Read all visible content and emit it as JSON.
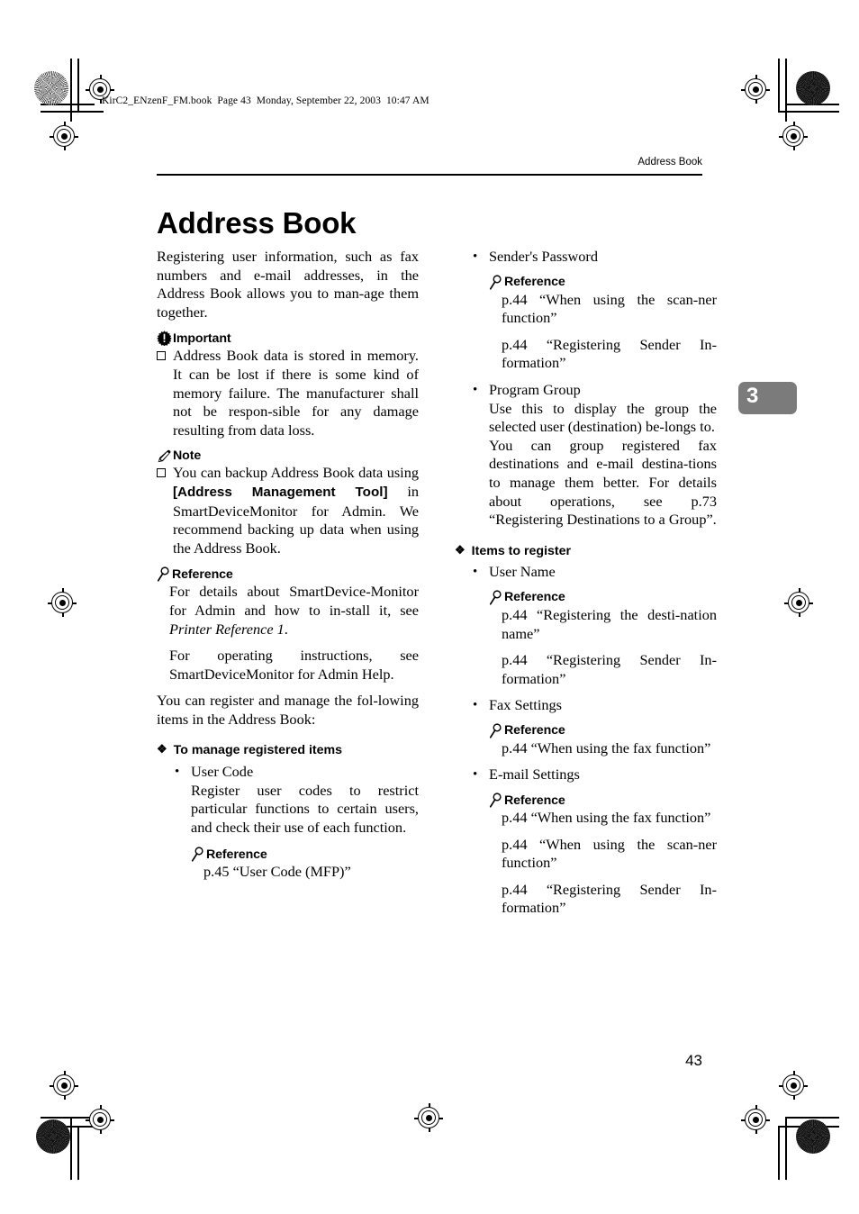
{
  "file_header": "KirC2_ENzenF_FM.book  Page 43  Monday, September 22, 2003  10:47 AM",
  "running_header": "Address Book",
  "chapter_title": "Address Book",
  "chapter_tab_number": "3",
  "page_number": "43",
  "colors": {
    "chapter_tab_background": "#7b7b7b",
    "chapter_tab_text": "#ffffff",
    "text": "#000000",
    "page_background": "#ffffff"
  },
  "left_column": {
    "intro": "Registering user information, such as fax numbers and e-mail addresses, in the Address Book allows you to man-age them together.",
    "important": {
      "heading": "Important",
      "icon": "important-starburst-icon",
      "items": [
        "Address Book data is stored in memory. It can be lost if there is some kind of memory failure. The manufacturer shall not be respon-sible for any damage resulting from data loss."
      ]
    },
    "note": {
      "heading": "Note",
      "icon": "note-pencil-icon",
      "item_part1": "You can backup Address Book data using ",
      "item_bold": "[Address Management Tool]",
      "item_part2": " in SmartDeviceMonitor for Admin. We recommend backing up data when using the Address Book."
    },
    "reference": {
      "heading": "Reference",
      "icon": "reference-magnifier-icon",
      "para1_pre": "For details about SmartDevice-Monitor for Admin and how to in-stall it, see ",
      "para1_italic": "Printer Reference 1",
      "para1_post": ".",
      "para2": "For operating instructions, see SmartDeviceMonitor for Admin Help."
    },
    "closing": "You can register and manage the fol-lowing items in the Address Book:",
    "section": {
      "heading": "To manage registered items",
      "bullet_icon": "diamond-bullet-icon",
      "items": [
        {
          "title": "User Code",
          "body": "Register user codes to restrict particular functions to certain users, and check their use of each function.",
          "reference": {
            "heading": "Reference",
            "icon": "reference-magnifier-icon",
            "entries": [
              "p.45 “User Code (MFP)”"
            ]
          }
        }
      ]
    }
  },
  "right_column": {
    "continued_items": [
      {
        "title": "Sender's Password",
        "body": "",
        "reference": {
          "heading": "Reference",
          "icon": "reference-magnifier-icon",
          "entries": [
            "p.44 “When using the scan-ner function”",
            "p.44 “Registering Sender In-formation”"
          ]
        }
      },
      {
        "title": "Program Group",
        "body": "Use this to display the group the selected user (destination) be-longs to.",
        "body2": "You can group registered fax destinations and e-mail destina-tions to manage them better. For details about operations, see p.73 “Registering Destinations to a Group”.",
        "reference": null
      }
    ],
    "section": {
      "heading": "Items to register",
      "bullet_icon": "diamond-bullet-icon",
      "items": [
        {
          "title": "User Name",
          "reference": {
            "heading": "Reference",
            "icon": "reference-magnifier-icon",
            "entries": [
              "p.44 “Registering the desti-nation name”",
              "p.44 “Registering Sender In-formation”"
            ]
          }
        },
        {
          "title": "Fax Settings",
          "reference": {
            "heading": "Reference",
            "icon": "reference-magnifier-icon",
            "entries": [
              "p.44 “When using the fax function”"
            ]
          }
        },
        {
          "title": "E-mail Settings",
          "reference": {
            "heading": "Reference",
            "icon": "reference-magnifier-icon",
            "entries": [
              "p.44 “When using the fax function”",
              "p.44 “When using the scan-ner function”",
              "p.44 “Registering Sender In-formation”"
            ]
          }
        }
      ]
    }
  }
}
